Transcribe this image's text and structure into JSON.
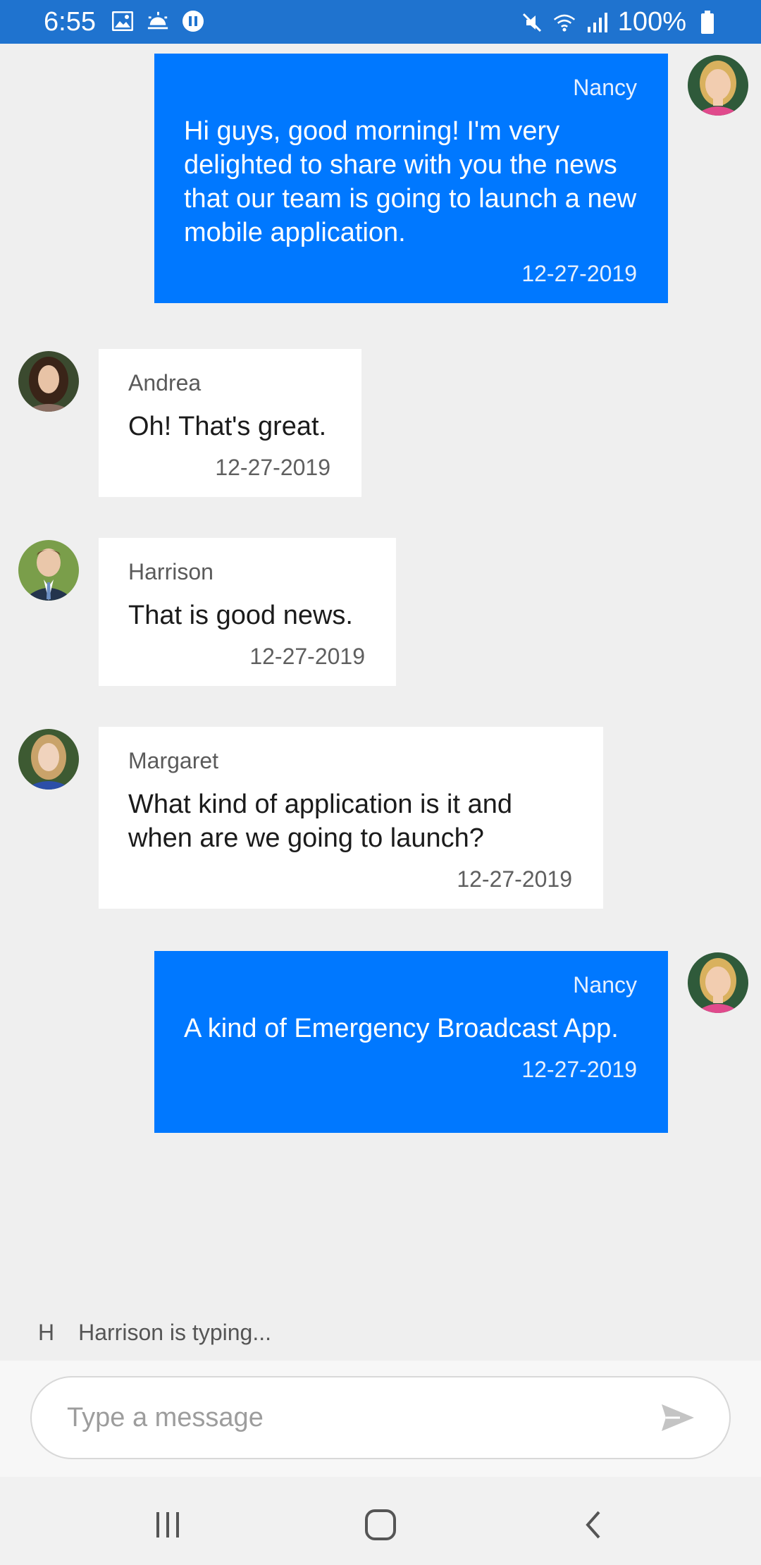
{
  "status_bar": {
    "time": "6:55",
    "battery_text": "100%",
    "left_icons": [
      "image-icon",
      "weather-icon",
      "media-icon"
    ],
    "right_icons": [
      "mute-icon",
      "wifi-icon",
      "signal-icon",
      "battery-icon"
    ]
  },
  "messages": [
    {
      "author": "Nancy",
      "text": "Hi guys, good morning! I'm very delighted to share with you the news that our team is going to launch a new mobile application.",
      "date": "12-27-2019",
      "direction": "outgoing"
    },
    {
      "author": "Andrea",
      "text": "Oh! That's great.",
      "date": "12-27-2019",
      "direction": "incoming"
    },
    {
      "author": "Harrison",
      "text": "That is good news.",
      "date": "12-27-2019",
      "direction": "incoming"
    },
    {
      "author": "Margaret",
      "text": "What kind of application is it and when are we going to launch?",
      "date": "12-27-2019",
      "direction": "incoming"
    },
    {
      "author": "Nancy",
      "text": "A kind of Emergency Broadcast App.",
      "date": "12-27-2019",
      "direction": "outgoing"
    }
  ],
  "typing": {
    "initial": "H",
    "text": "Harrison is typing..."
  },
  "composer": {
    "placeholder": "Type a message",
    "value": ""
  },
  "colors": {
    "status_bar": "#1f73cf",
    "outgoing_bubble": "#0078ff",
    "incoming_bubble": "#ffffff",
    "background": "#efefef"
  }
}
